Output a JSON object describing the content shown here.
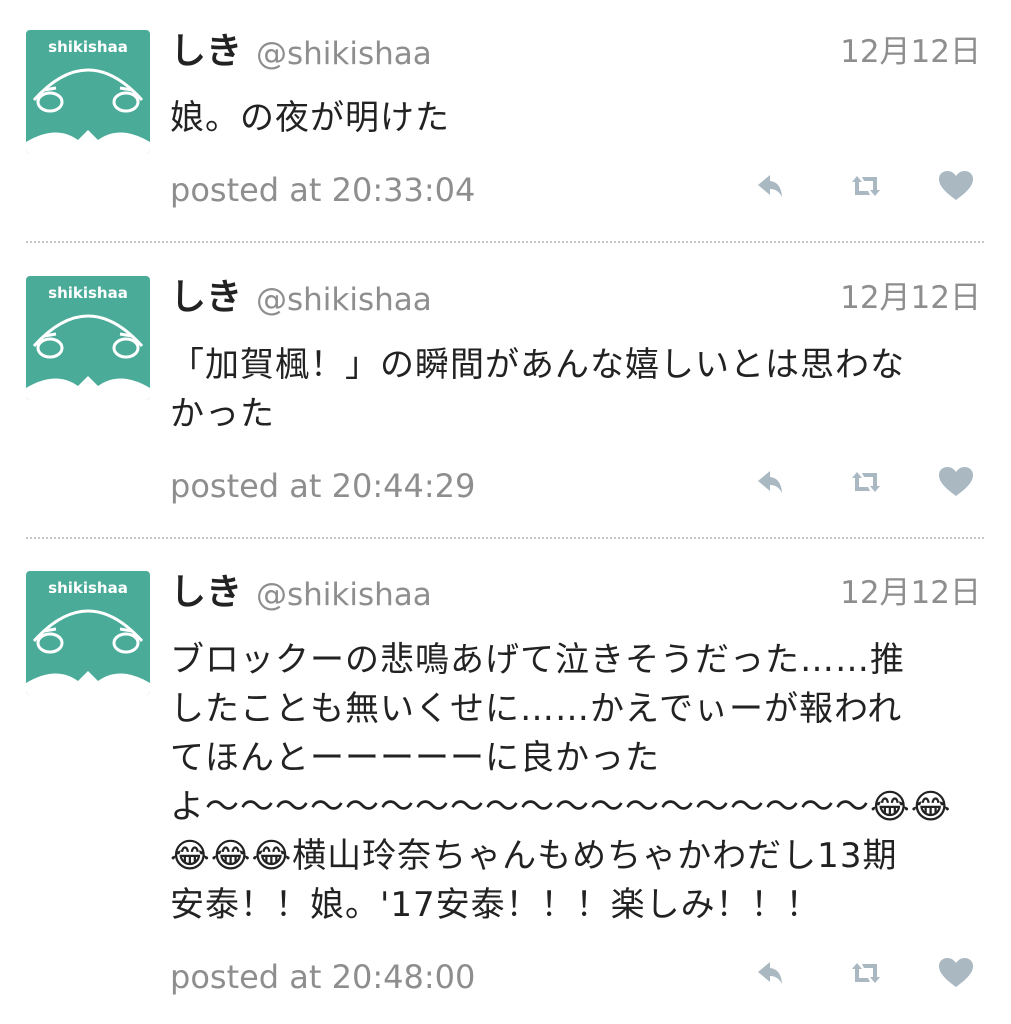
{
  "tweets": [
    {
      "avatar_text": "shikishaa",
      "name": "しき",
      "handle": "@shikishaa",
      "date": "12月12日",
      "body": "娘。の夜が明けた",
      "posted": "posted at 20:33:04"
    },
    {
      "avatar_text": "shikishaa",
      "name": "しき",
      "handle": "@shikishaa",
      "date": "12月12日",
      "body": "「加賀楓！」の瞬間があんな嬉しいとは思わな\nかった",
      "posted": "posted at 20:44:29"
    },
    {
      "avatar_text": "shikishaa",
      "name": "しき",
      "handle": "@shikishaa",
      "date": "12月12日",
      "body": "ブロックーの悲鳴あげて泣きそうだった……推\nしたことも無いくせに……かえでぃーが報われ\nてほんとーーーーーに良かった\nよ〜〜〜〜〜〜〜〜〜〜〜〜〜〜〜〜〜〜〜😂😂\n😂😂😂横山玲奈ちゃんもめちゃかわだし13期\n安泰！！娘。'17安泰！！！楽しみ！！！",
      "posted": "posted at 20:48:00"
    }
  ],
  "icons": {
    "reply": "reply-icon",
    "retweet": "retweet-icon",
    "like": "heart-icon"
  },
  "colors": {
    "avatar_bg": "#4aab98",
    "secondary_text": "#8e8e8e",
    "action_icon": "#aab8c2",
    "divider": "#c8c8c8"
  }
}
